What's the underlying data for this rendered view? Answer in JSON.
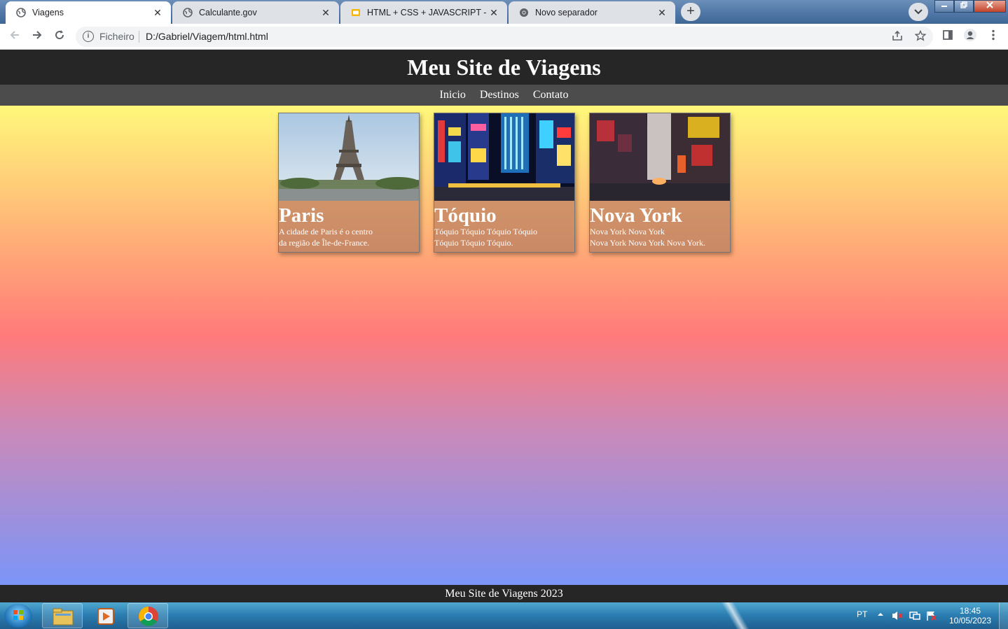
{
  "browser": {
    "tabs": [
      {
        "title": "Viagens",
        "active": true
      },
      {
        "title": "Calculante.gov",
        "active": false
      },
      {
        "title": "HTML + CSS + JAVASCRIPT - Goo",
        "active": false
      },
      {
        "title": "Novo separador",
        "active": false
      }
    ],
    "new_tab_symbol": "+",
    "close_symbol": "✕",
    "omnibox": {
      "scheme_label": "Ficheiro",
      "url": "D:/Gabriel/Viagem/html.html"
    }
  },
  "site": {
    "title": "Meu Site de Viagens",
    "nav": [
      "Inicio",
      "Destinos",
      "Contato"
    ],
    "cards": [
      {
        "title": "Paris",
        "text": "A cidade de Paris é o centro\nda região de Île-de-France."
      },
      {
        "title": "Tóquio",
        "text": "Tóquio Tóquio Tóquio Tóquio\nTóquio Tóquio Tóquio."
      },
      {
        "title": "Nova York",
        "text": "Nova York Nova York\nNova York Nova York Nova York."
      }
    ],
    "footer": "Meu Site de Viagens 2023"
  },
  "taskbar": {
    "language": "PT",
    "time": "18:45",
    "date": "10/05/2023"
  },
  "colors": {
    "header_bg": "#262626",
    "nav_bg": "#4c4c4c",
    "gradient_top": "#fff87a",
    "gradient_mid": "#ff7a7a",
    "gradient_bottom": "#7b95f8"
  }
}
